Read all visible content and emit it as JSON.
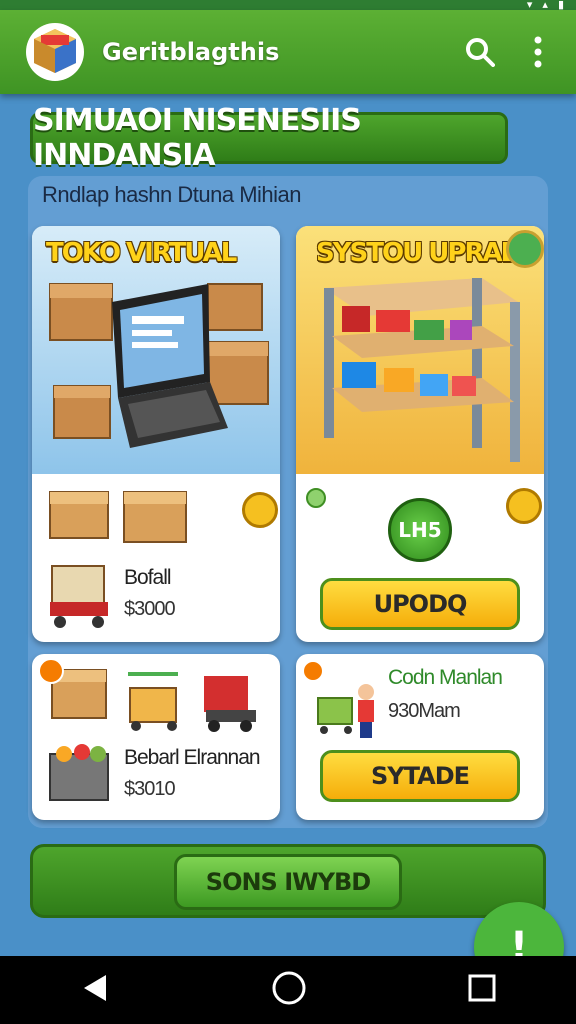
{
  "app": {
    "title": "Geritblagthis"
  },
  "banner": {
    "title": "SIMUAOI NISENESIIS INNDANSIA"
  },
  "subtitle": "Rndlap hashn Dtuna Mihian",
  "cards": {
    "toko": {
      "title": "TOKO VIRTUAL",
      "item_label": "Bofall",
      "item_price": "$3000"
    },
    "system": {
      "title": "SYSTOU UPRADE",
      "level": "LH5",
      "button": "UPODQ"
    },
    "bottom_left": {
      "label": "Bebarl Elrannan",
      "price": "$3010"
    },
    "bottom_right": {
      "label": "Codn Manlan",
      "value": "930Mam",
      "button": "SYTADE"
    }
  },
  "bottom_button": "SONS IWYBD",
  "fab": "!",
  "colors": {
    "appbar": "#4ea52c",
    "background": "#4a90c8",
    "button_yellow": "#f5c020"
  }
}
